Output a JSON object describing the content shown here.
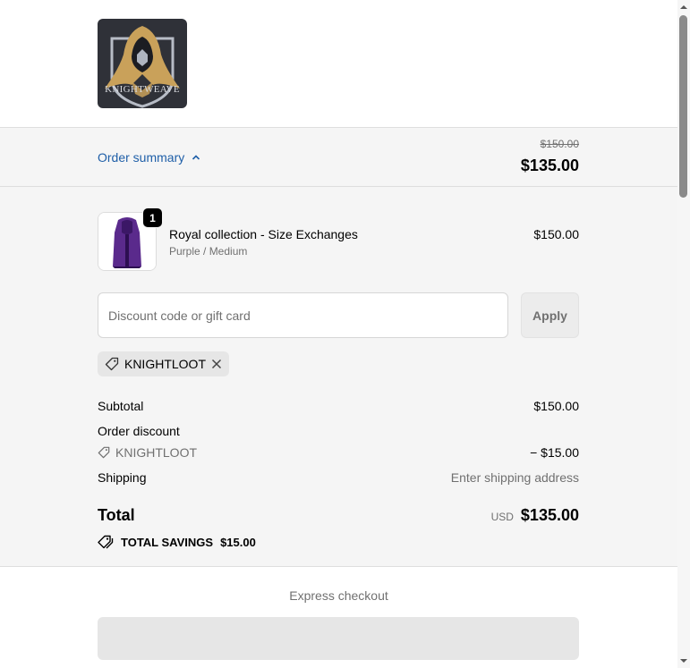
{
  "brand": {
    "logo_text": "KNIGHTWEAVE"
  },
  "order_summary": {
    "toggle_label": "Order summary",
    "original_price": "$150.00",
    "total_price": "$135.00"
  },
  "item": {
    "quantity": "1",
    "name": "Royal collection - Size Exchanges",
    "variant": "Purple / Medium",
    "price": "$150.00"
  },
  "discount": {
    "placeholder": "Discount code or gift card",
    "apply_label": "Apply",
    "applied_code": "KNIGHTLOOT"
  },
  "totals": {
    "subtotal_label": "Subtotal",
    "subtotal_value": "$150.00",
    "order_discount_label": "Order discount",
    "discount_code": "KNIGHTLOOT",
    "discount_value": "− $15.00",
    "shipping_label": "Shipping",
    "shipping_value": "Enter shipping address",
    "total_label": "Total",
    "currency": "USD",
    "total_value": "$135.00",
    "savings_label": "TOTAL SAVINGS",
    "savings_value": "$15.00"
  },
  "express": {
    "label": "Express checkout"
  },
  "colors": {
    "link": "#1f5fa8",
    "panel": "#f5f5f5",
    "logo_bg": "#2f3138",
    "logo_gold": "#c9a15a",
    "product": "#5a2a8c"
  }
}
